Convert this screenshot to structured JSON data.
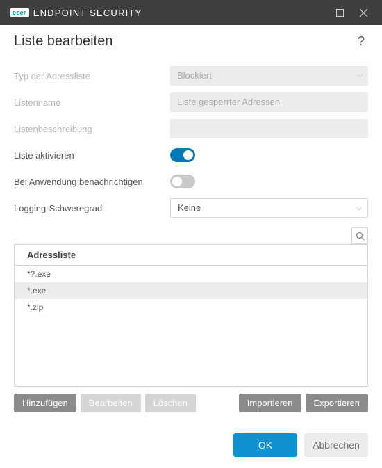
{
  "titlebar": {
    "brand_badge": "eser",
    "brand_text": "ENDPOINT SECURITY"
  },
  "dialog": {
    "title": "Liste bearbeiten",
    "help": "?"
  },
  "form": {
    "type_label": "Typ der Adressliste",
    "type_value": "Blockiert",
    "name_label": "Listenname",
    "name_value": "Liste gesperrter Adressen",
    "desc_label": "Listenbeschreibung",
    "desc_value": "",
    "activate_label": "Liste aktivieren",
    "notify_label": "Bei Anwendung benachrichtigen",
    "severity_label": "Logging-Schweregrad",
    "severity_value": "Keine"
  },
  "table": {
    "header": "Adressliste",
    "rows": [
      "*?.exe",
      "*.exe",
      "*.zip"
    ]
  },
  "actions": {
    "add": "Hinzufügen",
    "edit": "Bearbeiten",
    "delete": "Löschen",
    "import": "Importieren",
    "export": "Exportieren"
  },
  "footer": {
    "ok": "OK",
    "cancel": "Abbrechen"
  }
}
